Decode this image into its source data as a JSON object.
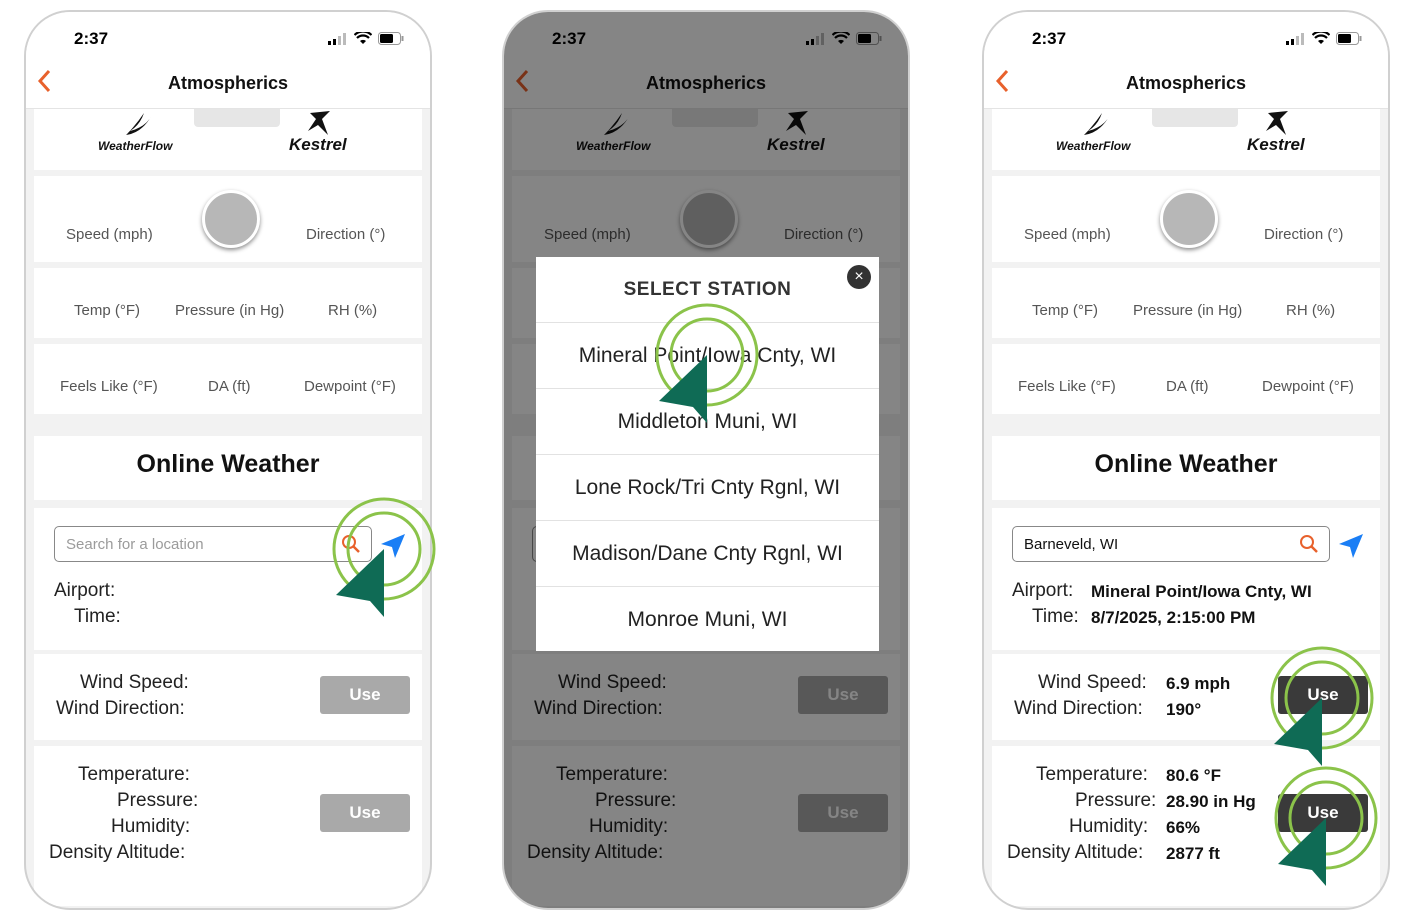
{
  "status": {
    "time": "2:37"
  },
  "nav": {
    "title": "Atmospherics",
    "back_glyph": "‹"
  },
  "logos": {
    "weatherflow": "WeatherFlow",
    "kestrel": "Kestrel"
  },
  "live": {
    "speed_label": "Speed (mph)",
    "direction_label": "Direction (°)",
    "temp_label": "Temp (°F)",
    "pressure_label": "Pressure (in Hg)",
    "rh_label": "RH (%)",
    "feels_like_label": "Feels Like (°F)",
    "da_label": "DA (ft)",
    "dewpoint_label": "Dewpoint (°F)"
  },
  "online": {
    "title": "Online Weather",
    "search_placeholder": "Search for a location",
    "airport_label": "Airport:",
    "time_label": "Time:",
    "wind_speed_label": "Wind Speed:",
    "wind_direction_label": "Wind Direction:",
    "temperature_label": "Temperature:",
    "pressure_label": "Pressure:",
    "humidity_label": "Humidity:",
    "density_altitude_label": "Density Altitude:",
    "use_label": "Use"
  },
  "modal": {
    "title": "SELECT STATION",
    "close_glyph": "×",
    "stations": [
      "Mineral Point/Iowa Cnty, WI",
      "Middleton Muni, WI",
      "Lone Rock/Tri Cnty Rgnl, WI",
      "Madison/Dane Cnty Rgnl, WI",
      "Monroe Muni, WI"
    ]
  },
  "result": {
    "search_value": "Barneveld, WI",
    "airport": "Mineral Point/Iowa Cnty, WI",
    "time": "8/7/2025, 2:15:00 PM",
    "wind_speed": "6.9 mph",
    "wind_direction": "190°",
    "temperature": "80.6 °F",
    "pressure": "28.90 in Hg",
    "humidity": "66%",
    "density_altitude": "2877 ft"
  },
  "colors": {
    "accent": "#e8612c",
    "location_arrow": "#1a7ef5",
    "use_inactive": "#a9a9a9",
    "use_active": "#3a3a3a",
    "cursor_fill": "#0f6b55",
    "cursor_ring": "#8bc34a"
  },
  "icons": {
    "back": "chevron-left-icon",
    "search": "magnifier-icon",
    "locate": "location-arrow-icon",
    "close": "close-icon",
    "cursor": "click-cursor-icon"
  }
}
